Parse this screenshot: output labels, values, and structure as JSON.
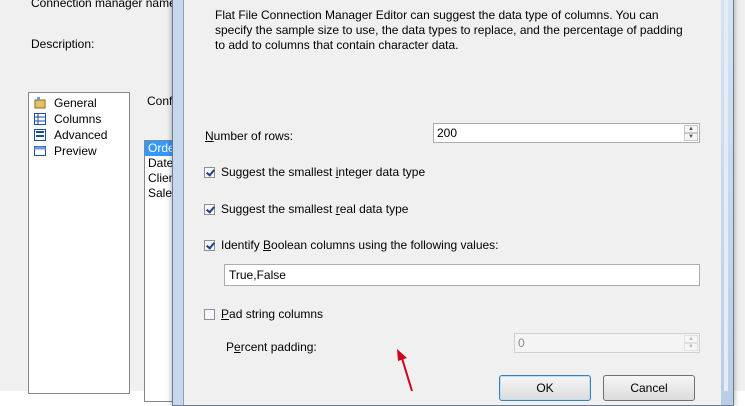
{
  "background_dialog": {
    "connection_manager_name_label": "Connection manager name:",
    "description_label": "Description:",
    "conf_label": "Conf",
    "nav_items": [
      {
        "label": "General",
        "icon": "general-icon"
      },
      {
        "label": "Columns",
        "icon": "columns-icon"
      },
      {
        "label": "Advanced",
        "icon": "advanced-icon"
      },
      {
        "label": "Preview",
        "icon": "preview-icon"
      }
    ],
    "column_items": [
      "Orde",
      "Date",
      "Clien",
      "Sales"
    ]
  },
  "modal": {
    "description": "Flat File Connection Manager Editor can suggest the data type of columns. You can specify the sample size to use, the data types to replace, and the percentage of padding to add to columns that contain character data.",
    "number_of_rows": {
      "label_pre": "",
      "label_u": "N",
      "label_post": "umber of rows:",
      "value": "200"
    },
    "suggest_integer": {
      "pre": "Suggest the smallest ",
      "u": "i",
      "post": "nteger data type",
      "checked": true
    },
    "suggest_real": {
      "pre": "Suggest the smallest ",
      "u": "r",
      "post": "eal data type",
      "checked": true
    },
    "identify_boolean": {
      "pre": "Identify ",
      "u": "B",
      "post": "oolean columns using the following values:",
      "checked": true
    },
    "boolean_values": "True,False",
    "pad_string": {
      "pre": "",
      "u": "P",
      "post": "ad string columns",
      "checked": false
    },
    "percent_padding": {
      "pre": "P",
      "u": "e",
      "post": "rcent padding:",
      "value": "0"
    },
    "ok_label": "OK",
    "cancel_label": "Cancel"
  },
  "colors": {
    "selection": "#3399ff",
    "annotation_arrow": "#d0021b",
    "frame": "#c7d8ec"
  }
}
